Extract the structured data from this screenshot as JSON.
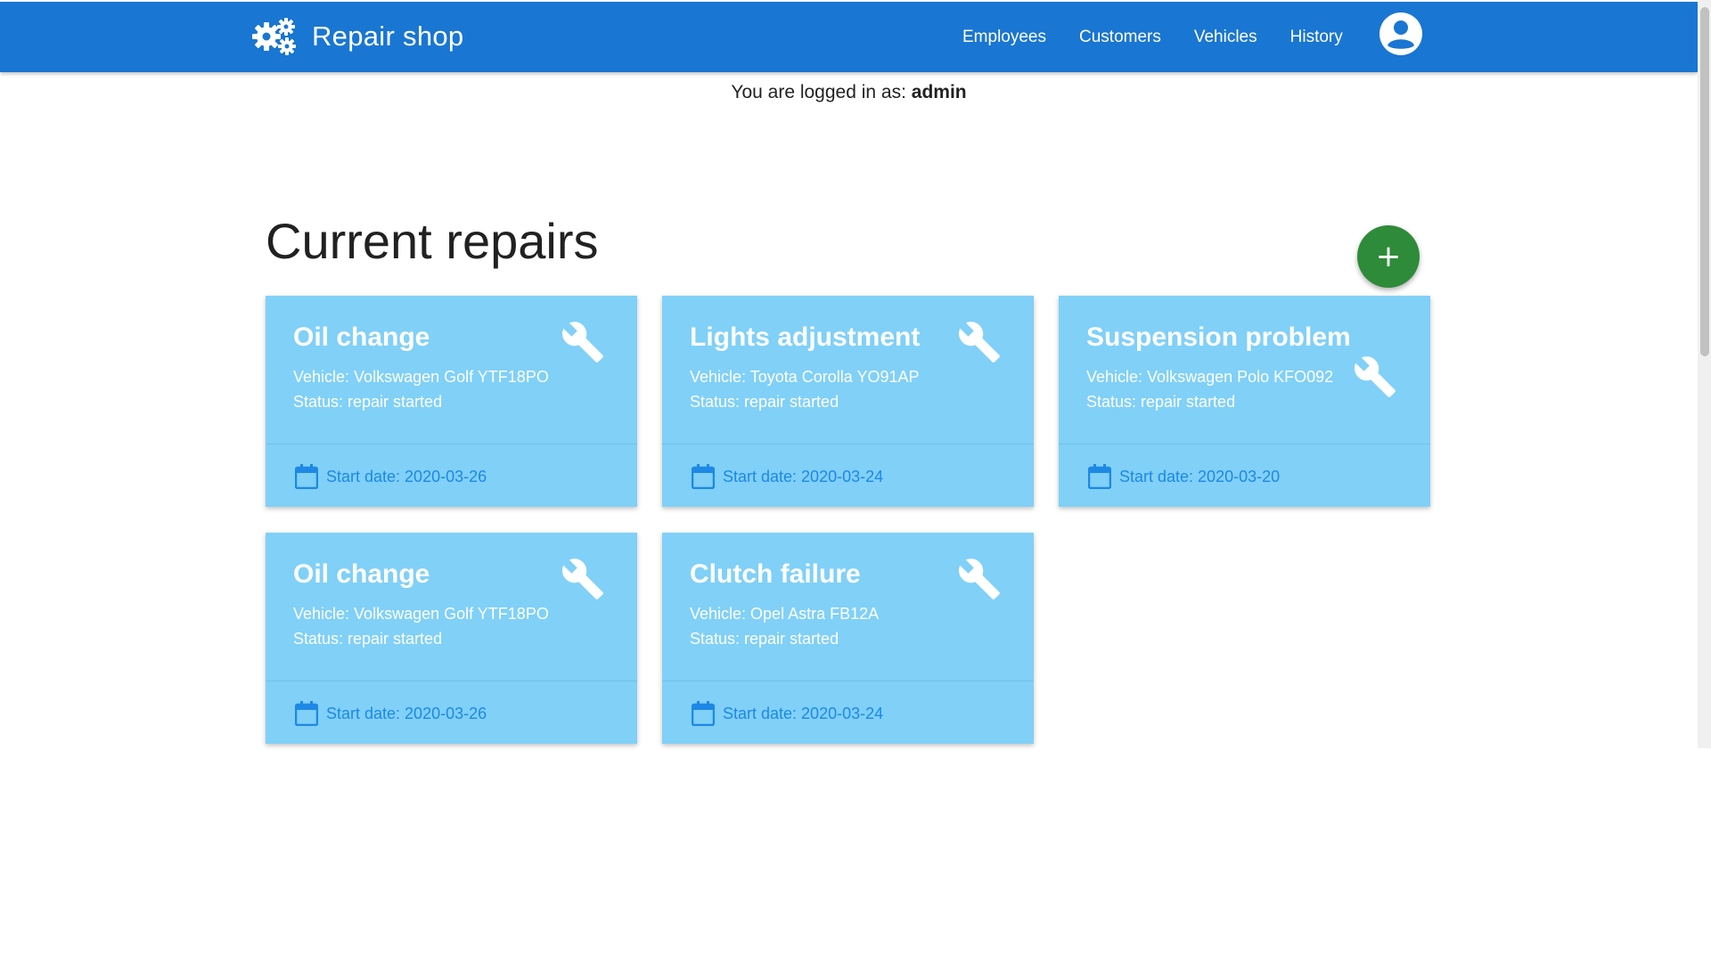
{
  "app": {
    "title": "Repair shop",
    "brand_icon": "gears-icon",
    "colors": {
      "appbar": "#1976d2",
      "card": "#80d0f8",
      "date_text": "#1e88e5",
      "fab": "#2e8b3a"
    }
  },
  "nav": {
    "items": [
      {
        "label": "Employees"
      },
      {
        "label": "Customers"
      },
      {
        "label": "Vehicles"
      },
      {
        "label": "History"
      }
    ],
    "account_icon": "account-circle-icon"
  },
  "session": {
    "prefix": "You are logged in as:",
    "username": "admin"
  },
  "main": {
    "title": "Current repairs",
    "add_button_label": "+",
    "cards": [
      {
        "title": "Oil change",
        "vehicle": "Vehicle: Volkswagen Golf YTF18PO",
        "status": "Status: repair started",
        "date": "Start date: 2020-03-26",
        "icon": "wrench-icon"
      },
      {
        "title": "Lights adjustment",
        "vehicle": "Vehicle: Toyota Corolla YO91AP",
        "status": "Status: repair started",
        "date": "Start date: 2020-03-24",
        "icon": "wrench-icon"
      },
      {
        "title": "Suspension problem",
        "vehicle": "Vehicle: Volkswagen Polo KFO092",
        "status": "Status: repair started",
        "date": "Start date: 2020-03-20",
        "icon": "wrench-icon"
      },
      {
        "title": "Oil change",
        "vehicle": "Vehicle: Volkswagen Golf YTF18PO",
        "status": "Status: repair started",
        "date": "Start date: 2020-03-26",
        "icon": "wrench-icon"
      },
      {
        "title": "Clutch failure",
        "vehicle": "Vehicle: Opel Astra FB12A",
        "status": "Status: repair started",
        "date": "Start date: 2020-03-24",
        "icon": "wrench-icon"
      }
    ]
  }
}
